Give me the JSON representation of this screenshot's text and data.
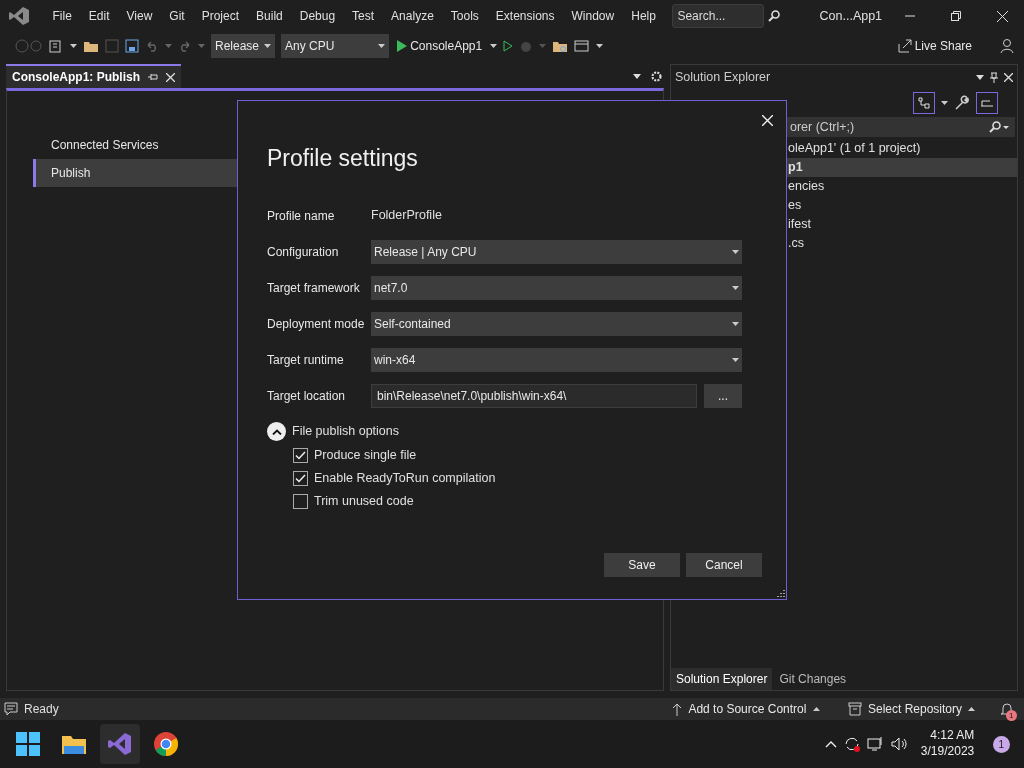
{
  "menu": [
    "File",
    "Edit",
    "View",
    "Git",
    "Project",
    "Build",
    "Debug",
    "Test",
    "Analyze",
    "Tools",
    "Extensions",
    "Window",
    "Help"
  ],
  "search": {
    "placeholder": "Search..."
  },
  "window_title": "Con...App1",
  "toolbar": {
    "configuration": "Release",
    "platform": "Any CPU",
    "start": "ConsoleApp1",
    "live_share": "Live Share"
  },
  "document_tab": {
    "title": "ConsoleApp1: Publish"
  },
  "nav": [
    {
      "label": "Connected Services",
      "selected": false
    },
    {
      "label": "Publish",
      "selected": true
    }
  ],
  "dialog": {
    "title": "Profile settings",
    "fields": [
      {
        "kind": "text",
        "label": "Profile name",
        "value": "FolderProfile"
      },
      {
        "kind": "dropdown",
        "label": "Configuration",
        "value": "Release | Any CPU"
      },
      {
        "kind": "dropdown",
        "label": "Target framework",
        "value": "net7.0"
      },
      {
        "kind": "dropdown",
        "label": "Deployment mode",
        "value": "Self-contained"
      },
      {
        "kind": "dropdown",
        "label": "Target runtime",
        "value": "win-x64"
      },
      {
        "kind": "path",
        "label": "Target location",
        "value": "bin\\Release\\net7.0\\publish\\win-x64\\",
        "button": "..."
      }
    ],
    "section": {
      "label": "File publish options",
      "expanded": true
    },
    "options": [
      {
        "label": "Produce single file",
        "checked": true
      },
      {
        "label": "Enable ReadyToRun compilation",
        "checked": true
      },
      {
        "label": "Trim unused code",
        "checked": false
      }
    ],
    "buttons": [
      "Save",
      "Cancel"
    ]
  },
  "solution_explorer": {
    "title": "Solution Explorer",
    "search_placeholder": "orer (Ctrl+;)",
    "items": [
      {
        "label": "oleApp1' (1 of 1 project)",
        "selected": false
      },
      {
        "label": "p1",
        "selected": true
      },
      {
        "label": "encies",
        "selected": false
      },
      {
        "label": "es",
        "selected": false
      },
      {
        "label": "ifest",
        "selected": false
      },
      {
        "label": ".cs",
        "selected": false
      }
    ],
    "tabs": [
      {
        "label": "Solution Explorer",
        "selected": true
      },
      {
        "label": "Git Changes",
        "selected": false
      }
    ]
  },
  "status_bar": {
    "text": "Ready",
    "source_control": "Add to Source Control",
    "repository": "Select Repository",
    "notifications": "1"
  },
  "taskbar": {
    "time": "4:12 AM",
    "date": "3/19/2023",
    "badge": "1"
  }
}
